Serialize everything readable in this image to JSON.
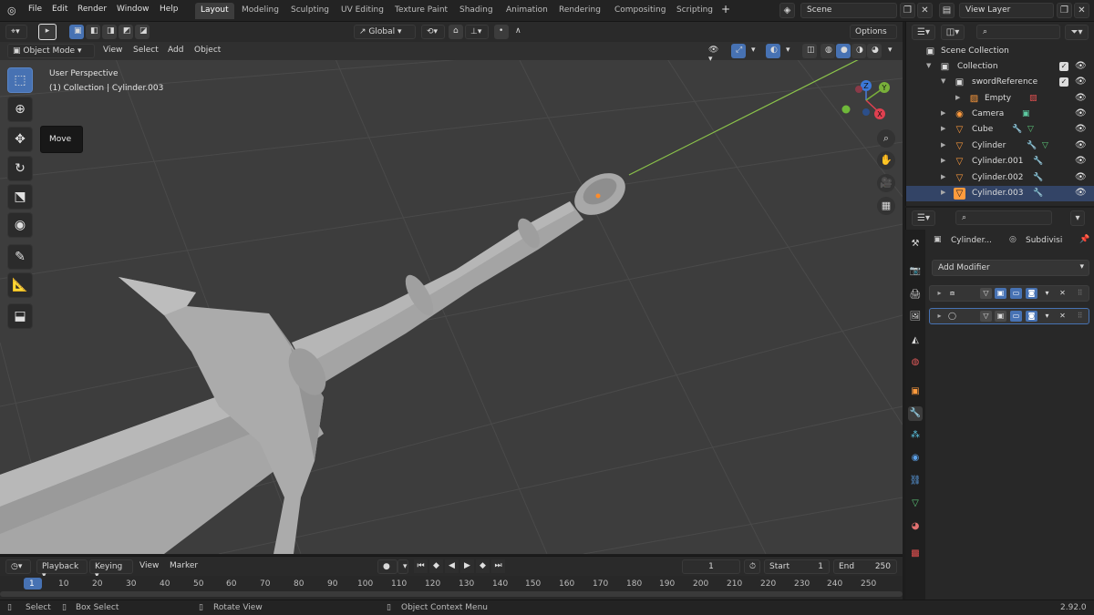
{
  "menu": {
    "file": "File",
    "edit": "Edit",
    "render": "Render",
    "window": "Window",
    "help": "Help"
  },
  "workspaces": [
    "Layout",
    "Modeling",
    "Sculpting",
    "UV Editing",
    "Texture Paint",
    "Shading",
    "Animation",
    "Rendering",
    "Compositing",
    "Scripting"
  ],
  "active_workspace": "Layout",
  "scene": {
    "name": "Scene"
  },
  "view_layer": {
    "name": "View Layer"
  },
  "viewport_header": {
    "mode": "Object Mode",
    "menus": [
      "View",
      "Select",
      "Add",
      "Object"
    ],
    "transform_orientation": "Global",
    "options_label": "Options"
  },
  "viewport": {
    "view_name": "User Perspective",
    "active_info": "(1) Collection | Cylinder.003",
    "tooltip": "Move",
    "gizmo": {
      "z": "Z",
      "y": "Y",
      "x": "X"
    }
  },
  "outliner": {
    "root": "Scene Collection",
    "items": [
      {
        "label": "Collection",
        "icon": "collection-icon"
      },
      {
        "label": "swordReference",
        "icon": "image-icon"
      },
      {
        "label": "Empty",
        "icon": "empty-icon"
      },
      {
        "label": "Camera",
        "icon": "camera-icon"
      },
      {
        "label": "Cube",
        "icon": "mesh-icon"
      },
      {
        "label": "Cylinder",
        "icon": "mesh-icon"
      },
      {
        "label": "Cylinder.001",
        "icon": "mesh-icon"
      },
      {
        "label": "Cylinder.002",
        "icon": "mesh-icon"
      },
      {
        "label": "Cylinder.003",
        "icon": "mesh-icon"
      }
    ]
  },
  "properties": {
    "object_name": "Cylinder...",
    "modifier_name": "Subdivisi",
    "add_modifier": "Add Modifier"
  },
  "timeline": {
    "menus": [
      "Playback",
      "Keying",
      "View",
      "Marker"
    ],
    "current_frame": "1",
    "start_label": "Start",
    "start_value": "1",
    "end_label": "End",
    "end_value": "250",
    "ruler": [
      "1",
      "10",
      "20",
      "30",
      "40",
      "50",
      "60",
      "70",
      "80",
      "90",
      "100",
      "110",
      "120",
      "130",
      "140",
      "150",
      "160",
      "170",
      "180",
      "190",
      "200",
      "210",
      "220",
      "230",
      "240",
      "250"
    ]
  },
  "statusbar": {
    "select": "Select",
    "box_select": "Box Select",
    "rotate_view": "Rotate View",
    "context_menu": "Object Context Menu",
    "version": "2.92.0"
  },
  "colors": {
    "accent": "#4772b3",
    "viewport_bg": "#3d3d3d",
    "object_orange": "#ff9b3d",
    "y_axis_line": "#8bc34a"
  }
}
